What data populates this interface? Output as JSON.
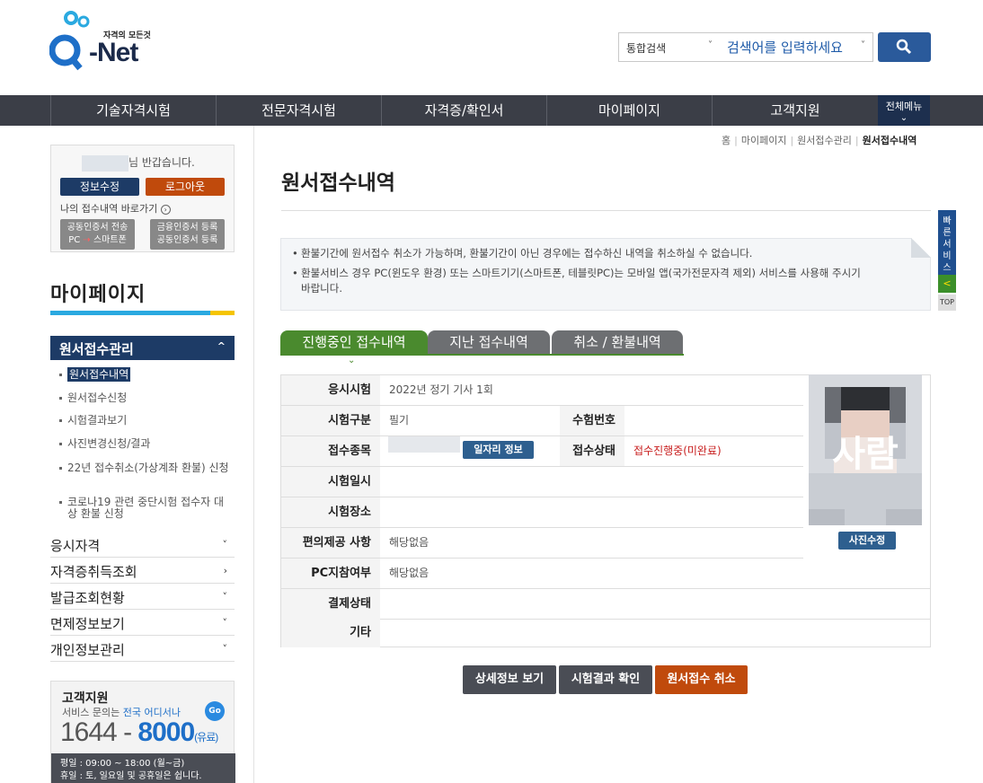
{
  "header": {
    "logo_tag": "자격의 모든것",
    "logo_text": "-Net",
    "search_select": "통합검색",
    "search_placeholder": "검색어를 입력하세요"
  },
  "nav": {
    "items": [
      "기술자격시험",
      "전문자격시험",
      "자격증/확인서",
      "마이페이지",
      "고객지원"
    ],
    "all_menu": "전체메뉴"
  },
  "sidebar": {
    "greeting": "님 반갑습니다.",
    "edit_info": "정보수정",
    "logout": "로그아웃",
    "quick_link": "나의 접수내역 바로가기",
    "cert1_line1": "공동인증서 전송",
    "cert1_line2a": "PC",
    "cert1_line2b": "스마트폰",
    "cert2_line1": "금융인증서 등록",
    "cert2_line2": "공동인증서 등록",
    "section_title": "마이페이지",
    "active_menu": "원서접수관리",
    "sub_items": [
      "원서접수내역",
      "원서접수신청",
      "시험결과보기",
      "사진변경신청/결과",
      "22년 접수취소(가상계좌 환불) 신청",
      "코로나19 관련 중단시험 접수자 대상 환불 신청"
    ],
    "menus": [
      "응시자격",
      "자격증취득조회",
      "발급조회현황",
      "면제정보보기",
      "개인정보관리"
    ],
    "cs": {
      "title": "고객지원",
      "sub_prefix": "서비스 문의는 ",
      "sub_highlight": "전국 어디서나",
      "go": "Go",
      "num1": "1644",
      "dash": " - ",
      "num2": "8000",
      "paid": "(유료)",
      "hours1": "평일 : 09:00 ~ 18:00 (월~금)",
      "hours2": "휴일 : 토, 일요일 및 공휴일은 쉽니다."
    }
  },
  "breadcrumb": [
    "홈",
    "마이페이지",
    "원서접수관리",
    "원서접수내역"
  ],
  "page_title": "원서접수내역",
  "notice": [
    "환불기간에 원서접수 취소가 가능하며, 환불기간이 아닌 경우에는 접수하신 내역을 취소하실 수 없습니다.",
    "환불서비스 경우 PC(윈도우 환경) 또는 스마트기기(스마트폰, 테블릿PC)는 모바일 앱(국가전문자격 제외) 서비스를 사용해 주시기 바랍니다."
  ],
  "quick": {
    "label": "빠른서비스",
    "arrow": "<",
    "top": "TOP"
  },
  "tabs": [
    "진행중인 접수내역",
    "지난 접수내역",
    "취소 / 환불내역"
  ],
  "table": {
    "exam_label": "응시시험",
    "exam_value": "2022년 정기 기사 1회",
    "type_label": "시험구분",
    "type_value": "필기",
    "examno_label": "수험번호",
    "examno_value": "",
    "receipt_label": "접수종목",
    "job_btn": "일자리 정보",
    "status_label": "접수상태",
    "status_value": "접수진행중(미완료)",
    "date_label": "시험일시",
    "date_value": "",
    "place_label": "시험장소",
    "place_value": "",
    "conv_label": "편의제공 사항",
    "conv_value": "해당없음",
    "pc_label": "PC지참여부",
    "pc_value": "해당없음",
    "pay_label": "결제상태",
    "pay_value": "",
    "etc_label": "기타",
    "etc_value": ""
  },
  "photo": {
    "overlay": "사람",
    "edit_btn": "사진수정"
  },
  "actions": [
    "상세정보 보기",
    "시험결과 확인",
    "원서접수 취소"
  ],
  "colors": {
    "nav": "#3b3e47",
    "navy": "#1d3b66",
    "tab_active": "#4a8a2e",
    "cancel": "#c04a0c",
    "dark_btn": "#4a4d55"
  }
}
